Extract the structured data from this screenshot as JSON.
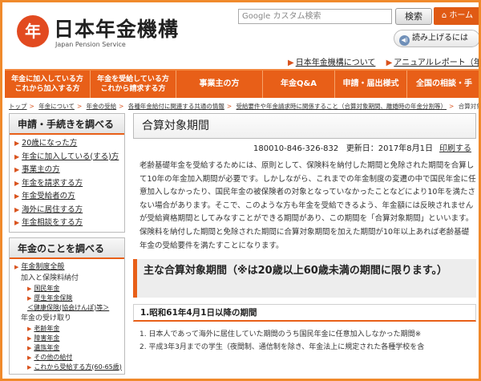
{
  "header": {
    "logo_char": "年",
    "logo_text": "日本年金機構",
    "logo_subtitle": "Japan Pension Service",
    "search_placeholder": "Google カスタム検索",
    "search_button": "検索",
    "home_button": "ホーム",
    "readaloud_button": "読み上げるには",
    "links": [
      "日本年金機構について",
      "アニュアルレポート（年"
    ]
  },
  "nav": [
    {
      "label": "年金に加入している方\nこれから加入する方"
    },
    {
      "label": "年金を受給している方\nこれから請求する方"
    },
    {
      "label": "事業主の方"
    },
    {
      "label": "年金Q&A"
    },
    {
      "label": "申請・届出様式"
    },
    {
      "label": "全国の相談・手"
    }
  ],
  "breadcrumb": [
    "トップ",
    "年金について",
    "年金の受給",
    "各種年金給付に関連する共通の情報",
    "受給要件や年金請求時に関係すること（合算対象期間、離婚時の年金分割等）",
    "合算対象期間"
  ],
  "sidebar": {
    "box1_title": "申請・手続きを調べる",
    "box1_items": [
      "20歳になった方",
      "年金に加入している(する)方",
      "事業主の方",
      "年金を請求する方",
      "年金受給者の方",
      "海外に居住する方",
      "年金相談をする方"
    ],
    "box2_title": "年金のことを調べる",
    "box2_top": "年金制度全般",
    "box2_group1": "加入と保険料納付",
    "box2_group1_items": [
      "国民年金",
      "厚生年金保険\n＜健康保険(協会けんぽ)等＞"
    ],
    "box2_group2": "年金の受け取り",
    "box2_group2_items": [
      "老齢年金",
      "障害年金",
      "遺族年金",
      "その他の給付",
      "これから受給する方(60-65歳)"
    ]
  },
  "main": {
    "title": "合算対象期間",
    "doc_id": "180010-846-326-832",
    "updated": "更新日：2017年8月1日",
    "print": "印刷する",
    "paragraph": "老齢基礎年金を受給するためには、原則として、保険料を納付した期間と免除された期間を合算して10年の年金加入期間が必要です。しかしながら、これまでの年金制度の変遷の中で国民年金に任意加入しなかったり、国民年金の被保険者の対象となっていなかったことなどにより10年を満たさない場合があります。そこで、このような方も年金を受給できるよう、年金額には反映されませんが受給資格期間としてみなすことができる期間があり、この期間を「合算対象期間」といいます。保険料を納付した期間と免除された期間に合算対象期間を加えた期間が10年以上あれば老齢基礎年金の受給要件を満たすことになります。",
    "section_heading": "主な合算対象期間（※は20歳以上60歳未満の期間に限ります。）",
    "sub_heading": "1.昭和61年4月1日以降の期間",
    "items": [
      "1. 日本人であって海外に居住していた期間のうち国民年金に任意加入しなかった期間※",
      "2. 平成3年3月までの学生（夜間制、通信制を除き、年金法上に規定された各種学校を含"
    ]
  }
}
